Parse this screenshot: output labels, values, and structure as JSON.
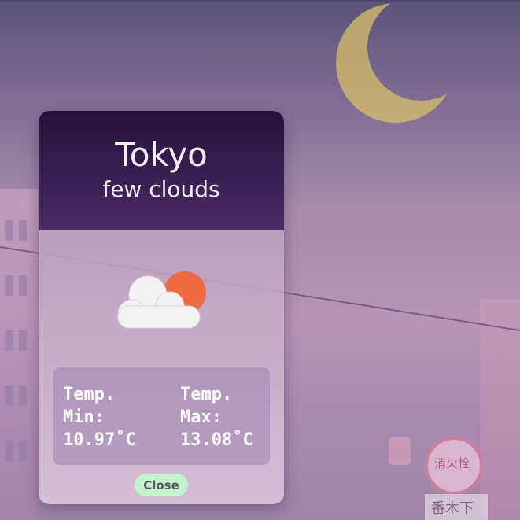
{
  "weather": {
    "city": "Tokyo",
    "description": "few clouds",
    "icon": "few-clouds-icon",
    "temp_min_label": "Temp. Min:",
    "temp_min_value": "10.97˚C",
    "temp_max_label": "Temp. Max:",
    "temp_max_value": "13.08˚C",
    "close_label": "Close"
  },
  "background": {
    "sign_text": "消火栓",
    "sign_bar_text": "番木下"
  },
  "colors": {
    "header_top": "#25123a",
    "header_bottom": "#4a2a62",
    "close_button": "#c4f2cf",
    "sun": "#ee6a40",
    "cloud": "#f2f2f2",
    "moon": "#d8c06a"
  }
}
